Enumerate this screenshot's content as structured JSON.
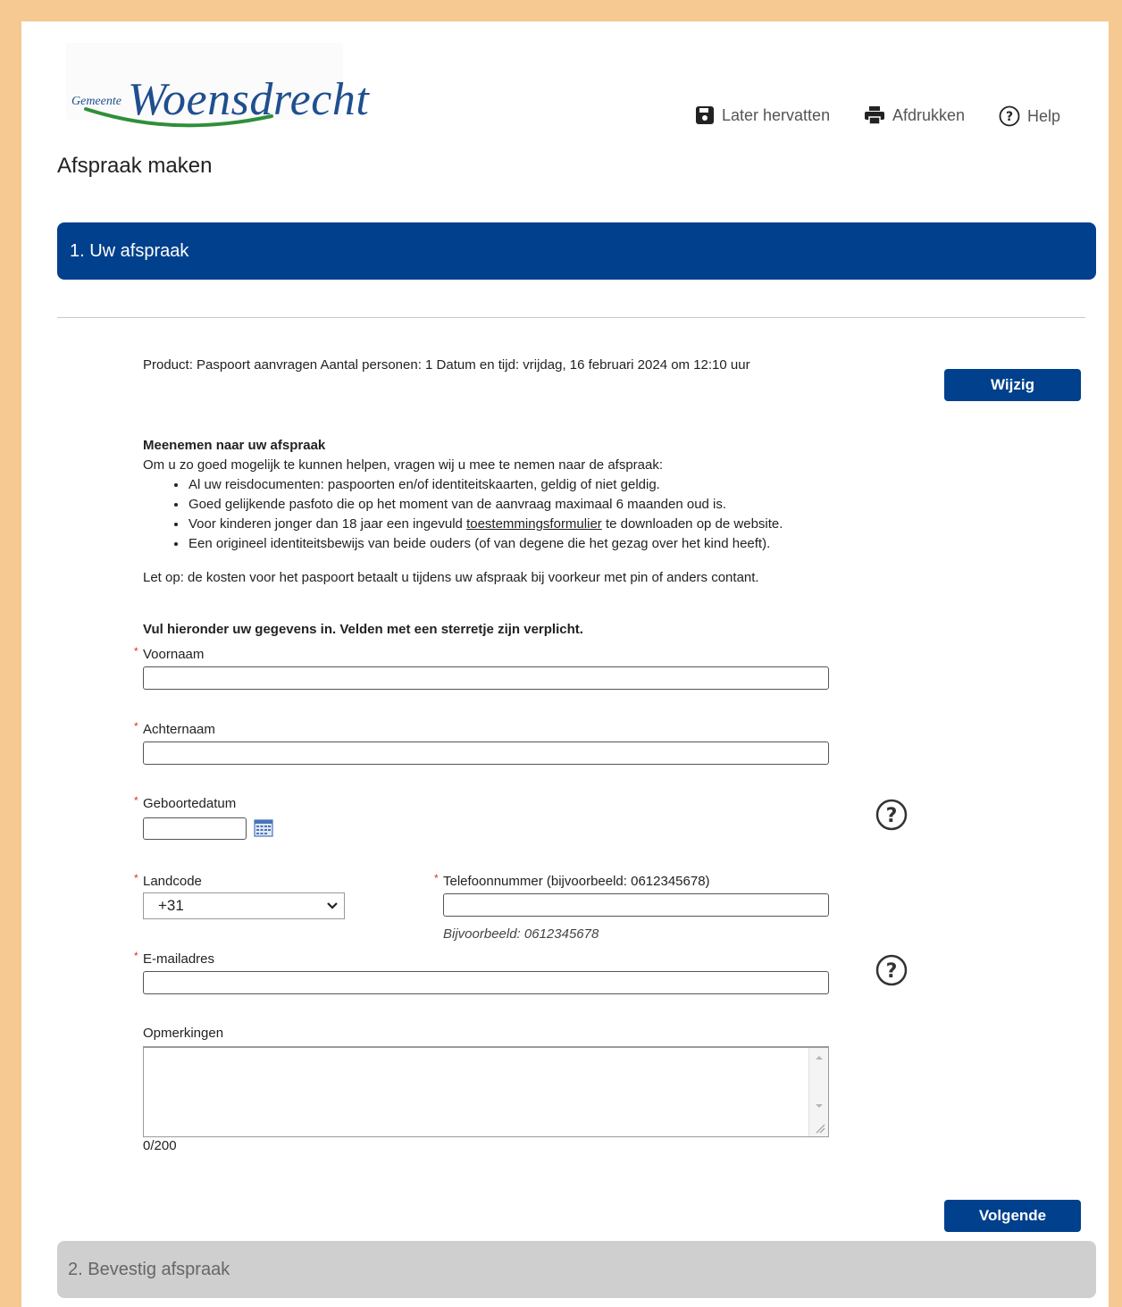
{
  "brand": {
    "logo_small": "Gemeente",
    "logo_big": "Woensdrecht",
    "colors": {
      "primary": "#00408c",
      "logo_blue": "#1f4f8f",
      "logo_green": "#2f8f3a",
      "frame": "#f6c892",
      "required": "#d2302c"
    }
  },
  "toolbar": {
    "resume_label": "Later hervatten",
    "resume_icon": "save-icon",
    "print_label": "Afdrukken",
    "print_icon": "printer-icon",
    "help_label": "Help",
    "help_icon": "question-circle-icon"
  },
  "page": {
    "title": "Afspraak maken"
  },
  "steps": {
    "step1": "1. Uw afspraak",
    "step2": "2. Bevestig afspraak"
  },
  "summary": {
    "text": "Product: Paspoort aanvragen Aantal personen: 1 Datum en tijd: vrijdag, 16 februari 2024 om 12:10 uur",
    "change_button": "Wijzig"
  },
  "bring": {
    "heading": "Meenemen naar uw afspraak",
    "intro": "Om u zo goed mogelijk te kunnen helpen, vragen wij u mee te nemen naar de afspraak:",
    "items": [
      "Al uw reisdocumenten: paspoorten en/of identiteitskaarten, geldig of niet geldig.",
      "Goed gelijkende pasfoto die op het moment van de aanvraag maximaal 6 maanden oud is."
    ],
    "item3_before": "Voor kinderen jonger dan 18 jaar een ingevuld ",
    "item3_link": "toestemmingsformulier",
    "item3_after": " te downloaden op de website.",
    "item4": "Een origineel identiteitsbewijs van beide ouders (of van degene die het gezag over het kind heeft).",
    "note": "Let op: de kosten voor het paspoort betaalt u tijdens uw afspraak bij voorkeur met pin of anders contant."
  },
  "form": {
    "instructions": "Vul hieronder uw gegevens in. Velden met een sterretje zijn verplicht.",
    "required_mark": "*",
    "first_name": {
      "label": "Voornaam",
      "value": ""
    },
    "last_name": {
      "label": "Achternaam",
      "value": ""
    },
    "birth_date": {
      "label": "Geboortedatum",
      "value": ""
    },
    "country_code": {
      "label": "Landcode",
      "value": "+31"
    },
    "phone": {
      "label": "Telefoonnummer (bijvoorbeeld: 0612345678)",
      "value": "",
      "hint": "Bijvoorbeeld: 0612345678"
    },
    "email": {
      "label": "E-mailadres",
      "value": ""
    },
    "remarks": {
      "label": "Opmerkingen",
      "value": "",
      "counter": "0/200"
    },
    "next_button": "Volgende"
  }
}
